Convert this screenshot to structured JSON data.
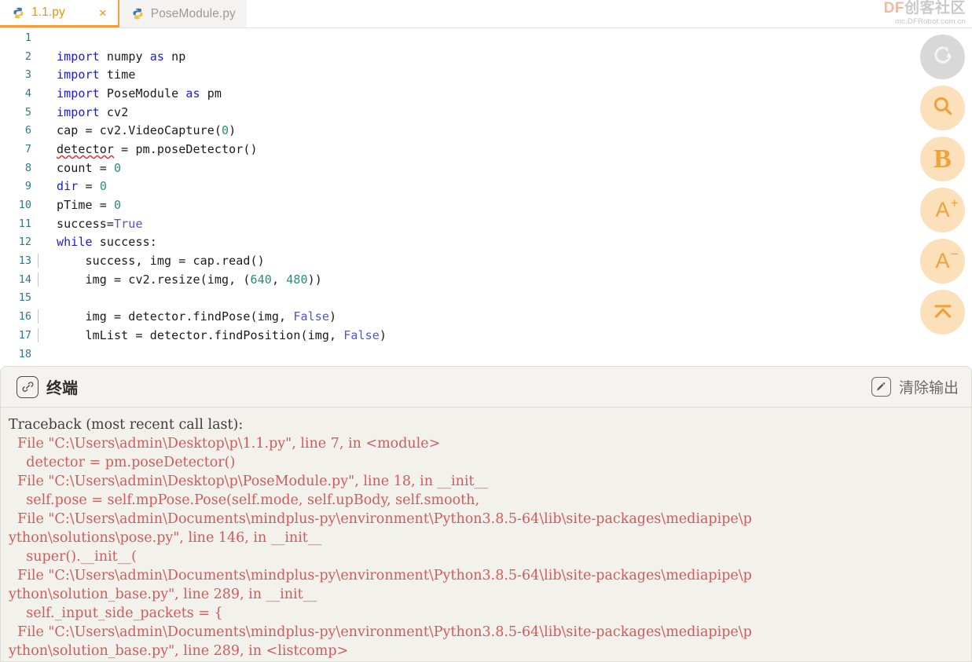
{
  "window": {
    "watermark_main_df": "DF",
    "watermark_main_cn": "创客社区",
    "watermark_sub": "mc.DFRobot.com.cn"
  },
  "tabs": [
    {
      "label": "1.1.py",
      "icon": "python-icon",
      "active": true,
      "close_label": "×"
    },
    {
      "label": "PoseModule.py",
      "icon": "python-icon",
      "active": false,
      "close_label": "×"
    }
  ],
  "editor": {
    "language": "python",
    "lines": [
      {
        "n": "1",
        "tokens": []
      },
      {
        "n": "2",
        "tokens": [
          {
            "t": "import",
            "c": "kw"
          },
          {
            "t": " numpy ",
            "c": "plain"
          },
          {
            "t": "as",
            "c": "kw"
          },
          {
            "t": " np",
            "c": "plain"
          }
        ]
      },
      {
        "n": "3",
        "tokens": [
          {
            "t": "import",
            "c": "kw"
          },
          {
            "t": " time",
            "c": "plain"
          }
        ]
      },
      {
        "n": "4",
        "tokens": [
          {
            "t": "import",
            "c": "kw"
          },
          {
            "t": " PoseModule ",
            "c": "plain"
          },
          {
            "t": "as",
            "c": "kw"
          },
          {
            "t": " pm",
            "c": "plain"
          }
        ]
      },
      {
        "n": "5",
        "tokens": [
          {
            "t": "import",
            "c": "kw"
          },
          {
            "t": " cv2",
            "c": "plain"
          }
        ]
      },
      {
        "n": "6",
        "tokens": [
          {
            "t": "cap = cv2.VideoCapture(",
            "c": "plain"
          },
          {
            "t": "0",
            "c": "num"
          },
          {
            "t": ")",
            "c": "plain"
          }
        ]
      },
      {
        "n": "7",
        "tokens": [
          {
            "t": "detector",
            "c": "squig"
          },
          {
            "t": " = pm.poseDetector()",
            "c": "plain"
          }
        ]
      },
      {
        "n": "8",
        "tokens": [
          {
            "t": "count = ",
            "c": "plain"
          },
          {
            "t": "0",
            "c": "num"
          }
        ]
      },
      {
        "n": "9",
        "tokens": [
          {
            "t": "dir",
            "c": "kw"
          },
          {
            "t": " = ",
            "c": "plain"
          },
          {
            "t": "0",
            "c": "num"
          }
        ]
      },
      {
        "n": "10",
        "tokens": [
          {
            "t": "pTime = ",
            "c": "plain"
          },
          {
            "t": "0",
            "c": "num"
          }
        ]
      },
      {
        "n": "11",
        "tokens": [
          {
            "t": "success=",
            "c": "plain"
          },
          {
            "t": "True",
            "c": "kw2"
          }
        ]
      },
      {
        "n": "12",
        "tokens": [
          {
            "t": "while",
            "c": "kw"
          },
          {
            "t": " success:",
            "c": "plain"
          }
        ]
      },
      {
        "n": "13",
        "tokens": [
          {
            "t": "    success, img = cap.read()",
            "c": "plain"
          }
        ],
        "guide": true
      },
      {
        "n": "14",
        "tokens": [
          {
            "t": "    img = cv2.resize(img, (",
            "c": "plain"
          },
          {
            "t": "640",
            "c": "num"
          },
          {
            "t": ", ",
            "c": "plain"
          },
          {
            "t": "480",
            "c": "num"
          },
          {
            "t": "))",
            "c": "plain"
          }
        ],
        "guide": true
      },
      {
        "n": "15",
        "tokens": [],
        "guide": true
      },
      {
        "n": "16",
        "tokens": [
          {
            "t": "    img = detector.findPose(img, ",
            "c": "plain"
          },
          {
            "t": "False",
            "c": "kw2"
          },
          {
            "t": ")",
            "c": "plain"
          }
        ],
        "guide": true
      },
      {
        "n": "17",
        "tokens": [
          {
            "t": "    lmList = detector.findPosition(img, ",
            "c": "plain"
          },
          {
            "t": "False",
            "c": "kw2"
          },
          {
            "t": ")",
            "c": "plain"
          }
        ],
        "guide": true
      },
      {
        "n": "18",
        "tokens": [],
        "guide": true
      }
    ]
  },
  "toolbar": {
    "buttons": [
      {
        "name": "refresh-icon",
        "kind": "refresh",
        "style": "grey",
        "label": ""
      },
      {
        "name": "search-icon",
        "kind": "search",
        "style": "orange",
        "label": ""
      },
      {
        "name": "bold-icon",
        "kind": "bold",
        "style": "orange",
        "label": "B"
      },
      {
        "name": "font-increase-icon",
        "kind": "fontplus",
        "style": "orange",
        "label": "A",
        "sup": "+"
      },
      {
        "name": "font-decrease-icon",
        "kind": "fontminus",
        "style": "orange",
        "label": "A",
        "sup": "−"
      },
      {
        "name": "collapse-up-icon",
        "kind": "collapse",
        "style": "orange",
        "label": ""
      }
    ]
  },
  "terminal": {
    "title": "终端",
    "title_icon": "link-icon",
    "clear_label": "清除输出",
    "clear_icon": "eraser-icon",
    "output": [
      {
        "text": "Traceback (most recent call last):",
        "kind": "header"
      },
      {
        "text": "  File \"C:\\Users\\admin\\Desktop\\p\\1.1.py\", line 7, in <module>",
        "kind": "error"
      },
      {
        "text": "    detector = pm.poseDetector()",
        "kind": "error"
      },
      {
        "text": "  File \"C:\\Users\\admin\\Desktop\\p\\PoseModule.py\", line 18, in __init__",
        "kind": "error"
      },
      {
        "text": "    self.pose = self.mpPose.Pose(self.mode, self.upBody, self.smooth,",
        "kind": "error"
      },
      {
        "text": "  File \"C:\\Users\\admin\\Documents\\mindplus-py\\environment\\Python3.8.5-64\\lib\\site-packages\\mediapipe\\p",
        "kind": "error"
      },
      {
        "text": "ython\\solutions\\pose.py\", line 146, in __init__",
        "kind": "error"
      },
      {
        "text": "    super().__init__(",
        "kind": "error"
      },
      {
        "text": "  File \"C:\\Users\\admin\\Documents\\mindplus-py\\environment\\Python3.8.5-64\\lib\\site-packages\\mediapipe\\p",
        "kind": "error"
      },
      {
        "text": "ython\\solution_base.py\", line 289, in __init__",
        "kind": "error"
      },
      {
        "text": "    self._input_side_packets = {",
        "kind": "error"
      },
      {
        "text": "  File \"C:\\Users\\admin\\Documents\\mindplus-py\\environment\\Python3.8.5-64\\lib\\site-packages\\mediapipe\\p",
        "kind": "error"
      },
      {
        "text": "ython\\solution_base.py\", line 289, in <listcomp>",
        "kind": "error"
      }
    ]
  },
  "colors": {
    "accent_orange": "#e8920f",
    "tab_underline": "#f29d38",
    "keyword_blue": "#1a1ae6",
    "number_teal": "#2a8c7a",
    "error_red": "#d15b5b",
    "terminal_bg": "#f2f1ec",
    "toolbar_btn": "#fbe0b9"
  }
}
